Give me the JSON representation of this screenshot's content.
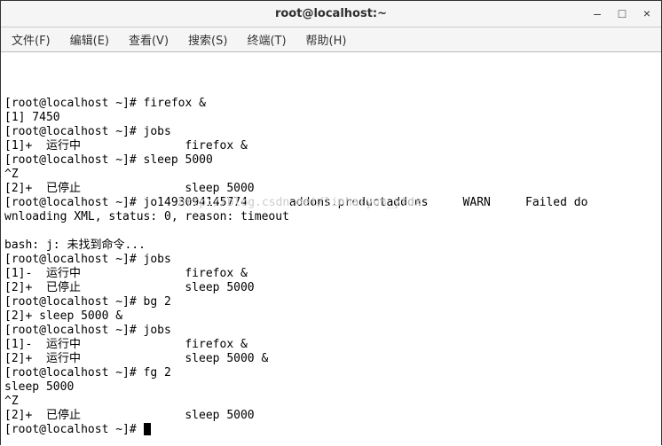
{
  "window": {
    "title": "root@localhost:~"
  },
  "controls": {
    "minimize": "–",
    "maximize": "□",
    "close": "×"
  },
  "menubar": {
    "file": "文件(F)",
    "edit": "编辑(E)",
    "view": "查看(V)",
    "search": "搜索(S)",
    "terminal": "终端(T)",
    "help": "帮助(H)"
  },
  "watermark": "http://blog.csdn.net/linhaiyun_ytdx",
  "terminal_lines": [
    "[root@localhost ~]# firefox &",
    "[1] 7450",
    "[root@localhost ~]# jobs",
    "[1]+  运行中               firefox &",
    "[root@localhost ~]# sleep 5000",
    "^Z",
    "[2]+  已停止               sleep 5000",
    "[root@localhost ~]# jo1493094145774      addons.productaddons     WARN     Failed do",
    "wnloading XML, status: 0, reason: timeout",
    "",
    "bash: j: 未找到命令...",
    "[root@localhost ~]# jobs",
    "[1]-  运行中               firefox &",
    "[2]+  已停止               sleep 5000",
    "[root@localhost ~]# bg 2",
    "[2]+ sleep 5000 &",
    "[root@localhost ~]# jobs",
    "[1]-  运行中               firefox &",
    "[2]+  运行中               sleep 5000 &",
    "[root@localhost ~]# fg 2",
    "sleep 5000",
    "^Z",
    "[2]+  已停止               sleep 5000",
    "[root@localhost ~]# "
  ]
}
